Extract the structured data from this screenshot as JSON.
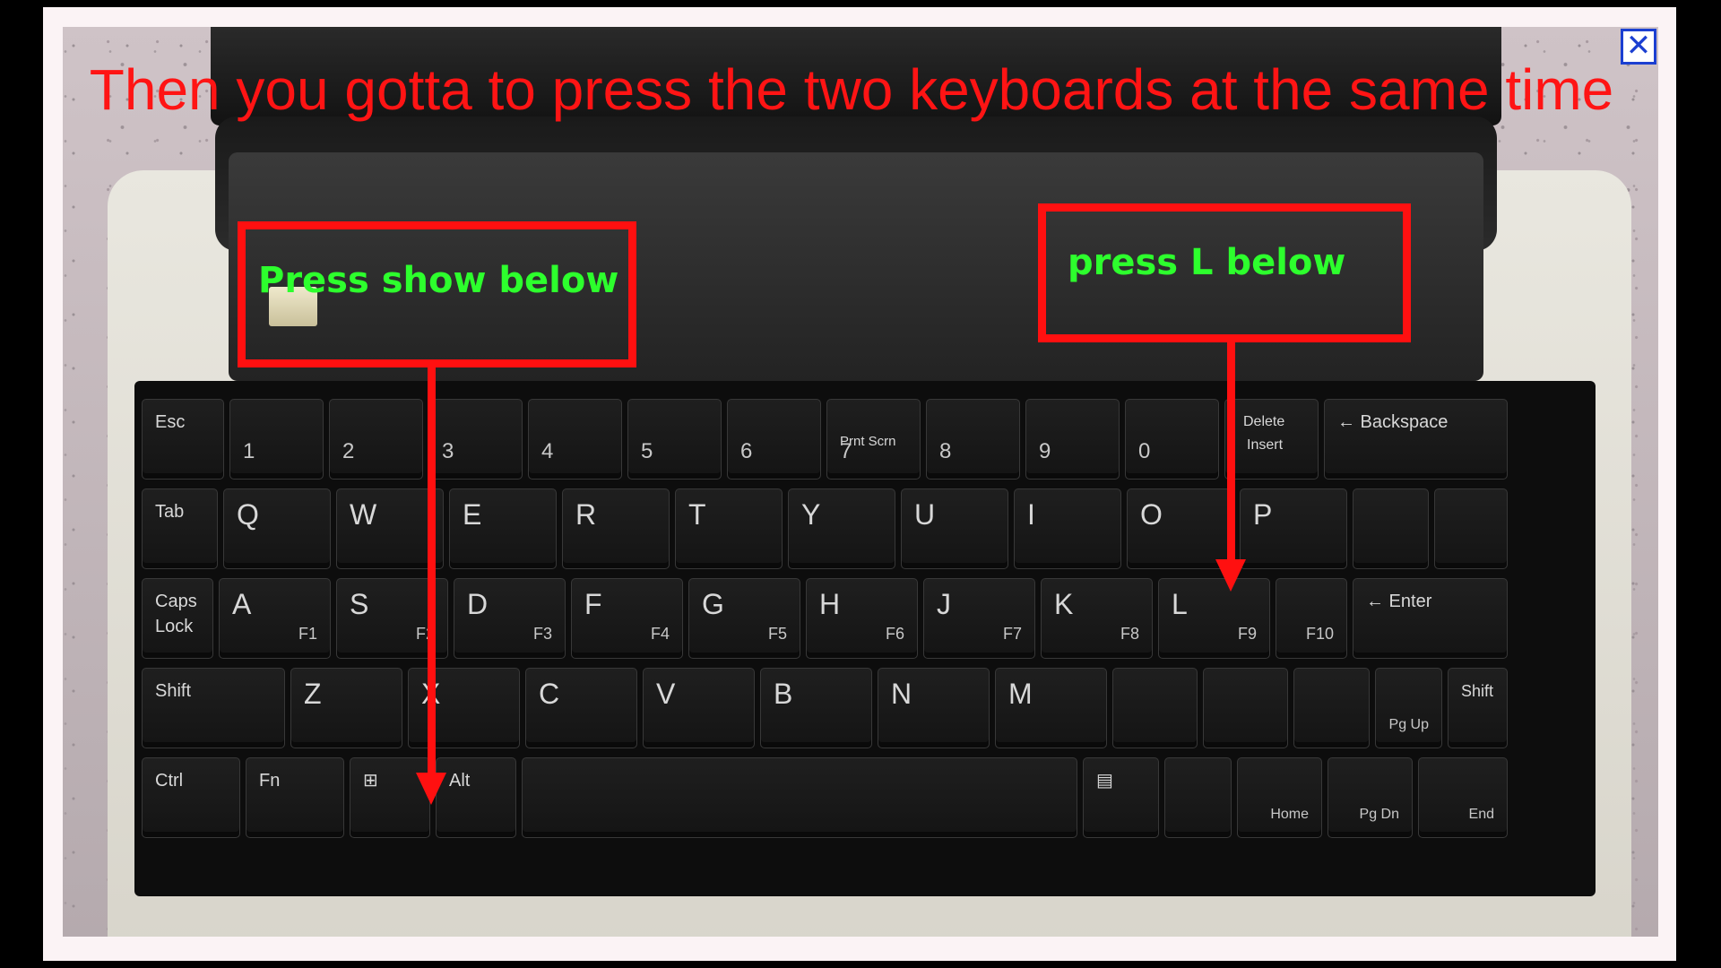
{
  "instruction": {
    "text": "Then you gotta to press the two keyboards at the same time"
  },
  "callouts": {
    "left": "Press show below",
    "right": "press L below"
  },
  "close_icon": "close-icon",
  "colors": {
    "instruction_text": "#ff1414",
    "callout_text": "#2dff2d",
    "callout_border": "#ff1010",
    "close_border": "#1b3fd1"
  },
  "keys": {
    "esc": "Esc",
    "n1": "1",
    "n2": "2",
    "n3": "3",
    "n4": "4",
    "n5": "5",
    "n6": "6",
    "n7": "7",
    "n8": "8",
    "n9": "9",
    "n0": "0",
    "delete": "Delete",
    "insert": "Insert",
    "backspace": "← Backspace",
    "tab": "Tab",
    "q": "Q",
    "w": "W",
    "e": "E",
    "r": "R",
    "t": "T",
    "y": "Y",
    "u": "U",
    "i": "I",
    "o": "O",
    "p": "P",
    "caps1": "Caps",
    "caps2": "Lock",
    "a": "A",
    "s": "S",
    "d": "D",
    "f": "F",
    "g": "G",
    "h": "H",
    "j": "J",
    "k": "K",
    "l": "L",
    "f1": "F1",
    "f2": "F2",
    "f3": "F3",
    "f4": "F4",
    "f5": "F5",
    "f6": "F6",
    "f7": "F7",
    "f8": "F8",
    "f9": "F9",
    "f10": "F10",
    "enter": "← Enter",
    "shift": "Shift",
    "z": "Z",
    "x": "X",
    "c": "C",
    "v": "V",
    "b": "B",
    "n": "N",
    "m": "M",
    "pgup": "Pg Up",
    "ctrl": "Ctrl",
    "fn": "Fn",
    "alt": "Alt",
    "home": "Home",
    "pgdn": "Pg Dn",
    "end": "End",
    "prtscn": "Prnt Scrn"
  }
}
